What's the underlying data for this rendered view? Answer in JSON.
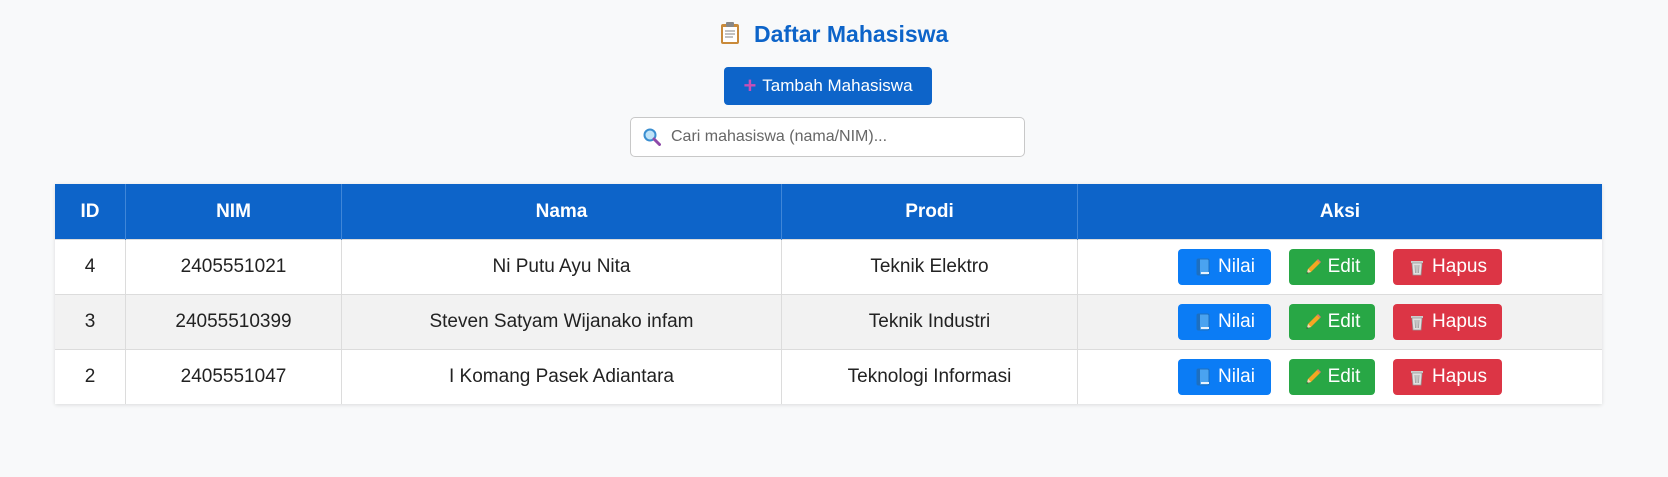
{
  "page": {
    "title": "Daftar Mahasiswa",
    "add_button": "Tambah Mahasiswa",
    "search_placeholder": "Cari mahasiswa (nama/NIM)..."
  },
  "table": {
    "headers": [
      "ID",
      "NIM",
      "Nama",
      "Prodi",
      "Aksi"
    ],
    "rows": [
      {
        "id": "4",
        "nim": "2405551021",
        "nama": "Ni Putu Ayu Nita",
        "prodi": "Teknik Elektro"
      },
      {
        "id": "3",
        "nim": "24055510399",
        "nama": "Steven Satyam Wijanako infam",
        "prodi": "Teknik Industri"
      },
      {
        "id": "2",
        "nim": "2405551047",
        "nama": "I Komang Pasek Adiantara",
        "prodi": "Teknologi Informasi"
      }
    ],
    "actions": {
      "nilai": "Nilai",
      "edit": "Edit",
      "hapus": "Hapus"
    }
  },
  "colors": {
    "primary": "#0d64c9",
    "nilai": "#0b7cf5",
    "edit": "#28a745",
    "hapus": "#dc3545"
  },
  "icons": {
    "title": "clipboard-icon",
    "add": "plus-icon",
    "search": "magnifier-icon",
    "nilai": "book-icon",
    "edit": "pencil-icon",
    "hapus": "wastebasket-icon"
  }
}
